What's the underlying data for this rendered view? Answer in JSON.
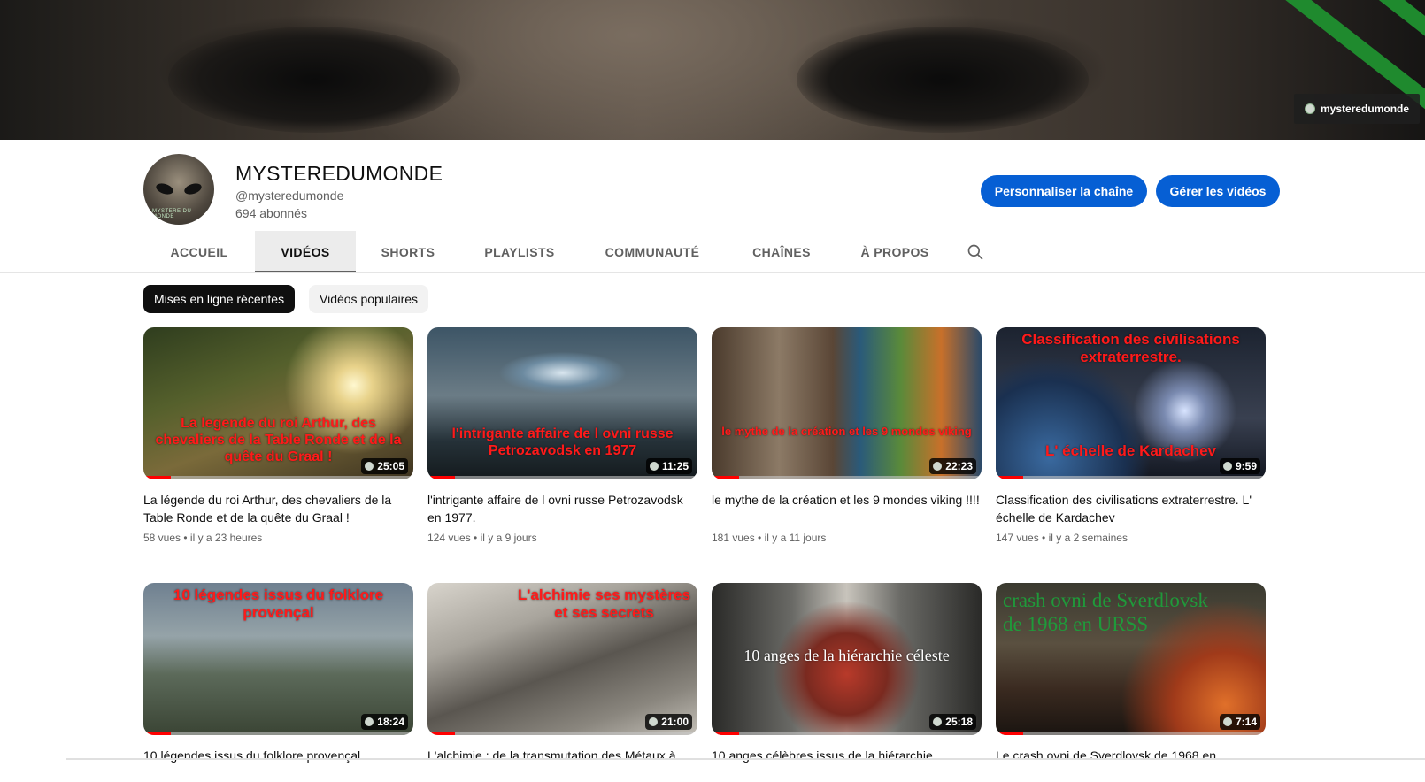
{
  "banner": {
    "badge_label": "mysteredumonde"
  },
  "channel": {
    "avatar_caption": "MYSTERE DU MONDE",
    "title": "MYSTEREDUMONDE",
    "handle": "@mysteredumonde",
    "subscribers": "694 abonnés",
    "customize_label": "Personnaliser la chaîne",
    "manage_label": "Gérer les vidéos"
  },
  "tabs": [
    {
      "label": "ACCUEIL",
      "active": false
    },
    {
      "label": "VIDÉOS",
      "active": true
    },
    {
      "label": "SHORTS",
      "active": false
    },
    {
      "label": "PLAYLISTS",
      "active": false
    },
    {
      "label": "COMMUNAUTÉ",
      "active": false
    },
    {
      "label": "CHAÎNES",
      "active": false
    },
    {
      "label": "À PROPOS",
      "active": false
    }
  ],
  "chips": {
    "recent": "Mises en ligne récentes",
    "popular": "Vidéos populaires"
  },
  "videos": [
    {
      "thumb_text": "La legende du roi Arthur, des chevaliers de la Table Ronde et de la quête du Graal !",
      "duration": "25:05",
      "title": "La légende du roi Arthur, des chevaliers de la Table Ronde et de la quête du Graal !",
      "views": "58 vues",
      "age": "il y a 23 heures",
      "progress": 0.1
    },
    {
      "thumb_text": "l'intrigante affaire de l ovni russe Petrozavodsk en 1977",
      "duration": "11:25",
      "title": "l'intrigante affaire de l ovni russe Petrozavodsk en 1977.",
      "views": "124 vues",
      "age": "il y a 9 jours",
      "progress": 0.1
    },
    {
      "thumb_text": "le mythe de la création et les 9 mondes viking",
      "duration": "22:23",
      "title": "le mythe de la création et les 9 mondes viking !!!!",
      "views": "181 vues",
      "age": "il y a 11 jours",
      "progress": 0.1
    },
    {
      "thumb_text": "Classification des civilisations extraterrestre.",
      "thumb_text2": "L' échelle de Kardachev",
      "duration": "9:59",
      "title": "Classification des civilisations extraterrestre. L' échelle de Kardachev",
      "views": "147 vues",
      "age": "il y a 2 semaines",
      "progress": 0.1
    },
    {
      "thumb_text": "10 légendes issus du folklore provençal",
      "duration": "18:24",
      "title": "10 légendes issus du folklore provençal",
      "views": "",
      "age": "",
      "progress": 0.1
    },
    {
      "thumb_text": "L'alchimie ses mystères et ses secrets",
      "duration": "21:00",
      "title": "L'alchimie : de la transmutation des Métaux à",
      "views": "",
      "age": "",
      "progress": 0.1
    },
    {
      "thumb_text": "10 anges de la hiérarchie céleste",
      "duration": "25:18",
      "title": "10 anges célèbres issus de la hiérarchie",
      "views": "",
      "age": "",
      "progress": 0.1
    },
    {
      "thumb_text": "crash ovni de Sverdlovsk de 1968 en URSS",
      "duration": "7:14",
      "title": "Le crash ovni de Sverdlovsk de 1968 en",
      "views": "",
      "age": "",
      "progress": 0.1
    }
  ],
  "colors": {
    "accent": "#065fd4",
    "progress": "#ff0000",
    "tab_text": "#606060"
  },
  "icons": {
    "search": "search-icon"
  }
}
